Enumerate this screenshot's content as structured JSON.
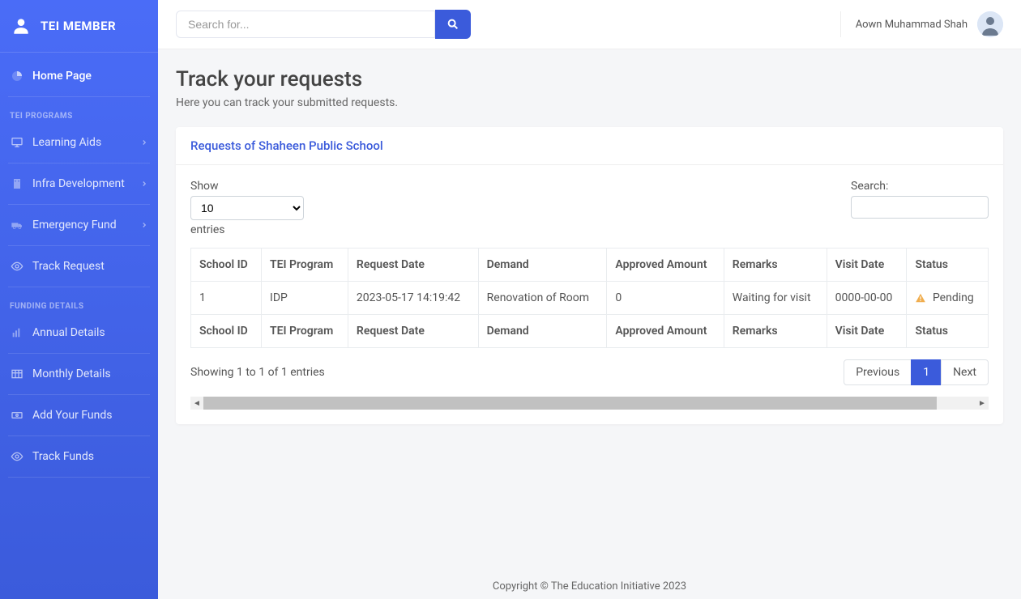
{
  "brand": "TEI MEMBER",
  "sidebar": {
    "home_label": "Home Page",
    "section1": "TEI PROGRAMS",
    "items1": [
      {
        "label": "Learning Aids",
        "has_sub": true
      },
      {
        "label": "Infra Development",
        "has_sub": true
      },
      {
        "label": "Emergency Fund",
        "has_sub": true
      },
      {
        "label": "Track Request",
        "has_sub": false
      }
    ],
    "section2": "FUNDING DETAILS",
    "items2": [
      {
        "label": "Annual Details"
      },
      {
        "label": "Monthly Details"
      },
      {
        "label": "Add Your Funds"
      },
      {
        "label": "Track Funds"
      }
    ]
  },
  "topbar": {
    "search_placeholder": "Search for...",
    "user_name": "Aown Muhammad Shah"
  },
  "page": {
    "title": "Track your requests",
    "subtitle": "Here you can track your submitted requests."
  },
  "card": {
    "header": "Requests of Shaheen Public School"
  },
  "table_controls": {
    "show_label": "Show",
    "entries_label": "entries",
    "length_value": "10",
    "search_label": "Search:"
  },
  "table": {
    "columns": [
      "School ID",
      "TEI Program",
      "Request Date",
      "Demand",
      "Approved Amount",
      "Remarks",
      "Visit Date",
      "Status"
    ],
    "rows": [
      {
        "school_id": "1",
        "program": "IDP",
        "request_date": "2023-05-17 14:19:42",
        "demand": "Renovation of Room",
        "approved": "0",
        "remarks": "Waiting for visit",
        "visit_date": "0000-00-00",
        "status": "Pending"
      }
    ]
  },
  "table_footer": {
    "info": "Showing 1 to 1 of 1 entries",
    "prev": "Previous",
    "page": "1",
    "next": "Next"
  },
  "footer": "Copyright © The Education Initiative 2023"
}
